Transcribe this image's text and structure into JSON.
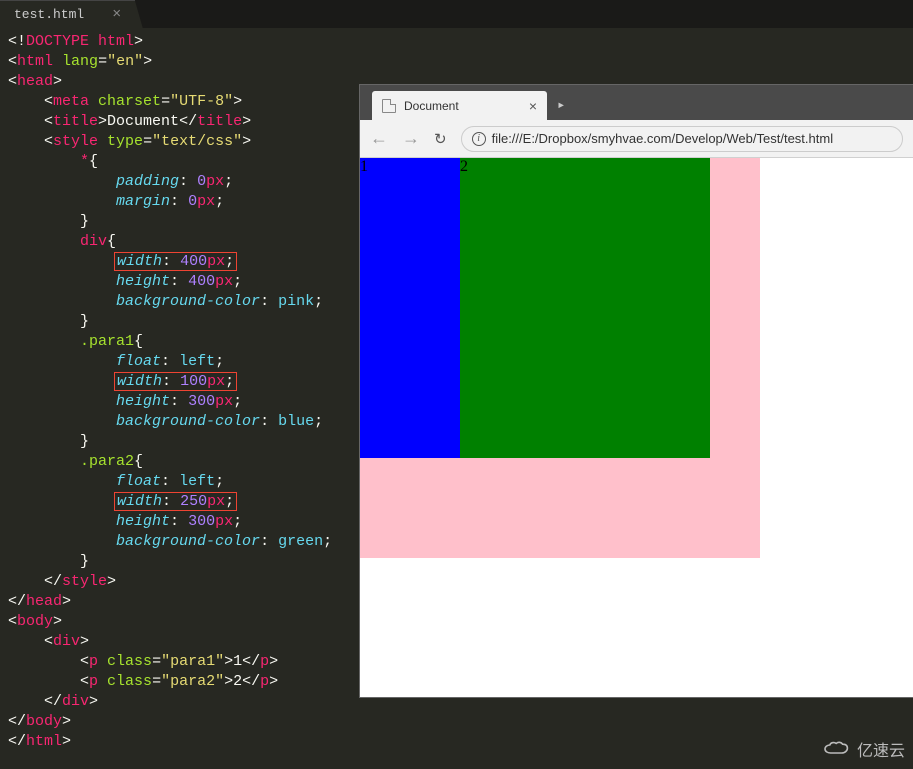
{
  "editor": {
    "tab": {
      "name": "test.html",
      "close": "×"
    },
    "code": {
      "l01a": "<!",
      "l01b": "DOCTYPE html",
      "l01c": ">",
      "l02a": "<",
      "l02b": "html",
      "l02c": " ",
      "l02d": "lang",
      "l02e": "=",
      "l02f": "\"en\"",
      "l02g": ">",
      "l03a": "<",
      "l03b": "head",
      "l03c": ">",
      "l04a": "    <",
      "l04b": "meta",
      "l04c": " ",
      "l04d": "charset",
      "l04e": "=",
      "l04f": "\"UTF-8\"",
      "l04g": ">",
      "l05a": "    <",
      "l05b": "title",
      "l05c": ">",
      "l05d": "Document",
      "l05e": "</",
      "l05f": "title",
      "l05g": ">",
      "l06a": "    <",
      "l06b": "style",
      "l06c": " ",
      "l06d": "type",
      "l06e": "=",
      "l06f": "\"text/css\"",
      "l06g": ">",
      "l07a": "        ",
      "l07b": "*",
      "l07c": "{",
      "l08a": "            ",
      "l08b": "padding",
      "l08c": ": ",
      "l08d": "0",
      "l08e": "px",
      "l08f": ";",
      "l09a": "            ",
      "l09b": "margin",
      "l09c": ": ",
      "l09d": "0",
      "l09e": "px",
      "l09f": ";",
      "l10a": "        }",
      "l11a": "        ",
      "l11b": "div",
      "l11c": "{",
      "l12a": "            ",
      "l12b": "width",
      "l12c": ": ",
      "l12d": "400",
      "l12e": "px",
      "l12f": ";",
      "l13a": "            ",
      "l13b": "height",
      "l13c": ": ",
      "l13d": "400",
      "l13e": "px",
      "l13f": ";",
      "l14a": "            ",
      "l14b": "background-color",
      "l14c": ": ",
      "l14d": "pink",
      "l14e": ";",
      "l15a": "        }",
      "l16a": "        ",
      "l16b": ".para1",
      "l16c": "{",
      "l17a": "            ",
      "l17b": "float",
      "l17c": ": ",
      "l17d": "left",
      "l17e": ";",
      "l18a": "            ",
      "l18b": "width",
      "l18c": ": ",
      "l18d": "100",
      "l18e": "px",
      "l18f": ";",
      "l19a": "            ",
      "l19b": "height",
      "l19c": ": ",
      "l19d": "300",
      "l19e": "px",
      "l19f": ";",
      "l20a": "            ",
      "l20b": "background-color",
      "l20c": ": ",
      "l20d": "blue",
      "l20e": ";",
      "l21a": "        }",
      "l22a": "        ",
      "l22b": ".para2",
      "l22c": "{",
      "l23a": "            ",
      "l23b": "float",
      "l23c": ": ",
      "l23d": "left",
      "l23e": ";",
      "l24a": "            ",
      "l24b": "width",
      "l24c": ": ",
      "l24d": "250",
      "l24e": "px",
      "l24f": ";",
      "l25a": "            ",
      "l25b": "height",
      "l25c": ": ",
      "l25d": "300",
      "l25e": "px",
      "l25f": ";",
      "l26a": "            ",
      "l26b": "background-color",
      "l26c": ": ",
      "l26d": "green",
      "l26e": ";",
      "l27a": "        }",
      "l28a": "    </",
      "l28b": "style",
      "l28c": ">",
      "l29a": "</",
      "l29b": "head",
      "l29c": ">",
      "l30a": "<",
      "l30b": "body",
      "l30c": ">",
      "l31a": "    <",
      "l31b": "div",
      "l31c": ">",
      "l32a": "        <",
      "l32b": "p",
      "l32c": " ",
      "l32d": "class",
      "l32e": "=",
      "l32f": "\"para1\"",
      "l32g": ">",
      "l32h": "1",
      "l32i": "</",
      "l32j": "p",
      "l32k": ">",
      "l33a": "        <",
      "l33b": "p",
      "l33c": " ",
      "l33d": "class",
      "l33e": "=",
      "l33f": "\"para2\"",
      "l33g": ">",
      "l33h": "2",
      "l33i": "</",
      "l33j": "p",
      "l33k": ">",
      "l34a": "    </",
      "l34b": "div",
      "l34c": ">",
      "l35a": "</",
      "l35b": "body",
      "l35c": ">",
      "l36a": "</",
      "l36b": "html",
      "l36c": ">"
    }
  },
  "browser": {
    "tabTitle": "Document",
    "tabClose": "×",
    "newTab": "▸",
    "navBack": "←",
    "navFwd": "→",
    "reload": "↻",
    "info": "i",
    "url": "file:///E:/Dropbox/smyhvae.com/Develop/Web/Test/test.html"
  },
  "page": {
    "p1": "1",
    "p2": "2"
  },
  "watermark": "亿速云"
}
